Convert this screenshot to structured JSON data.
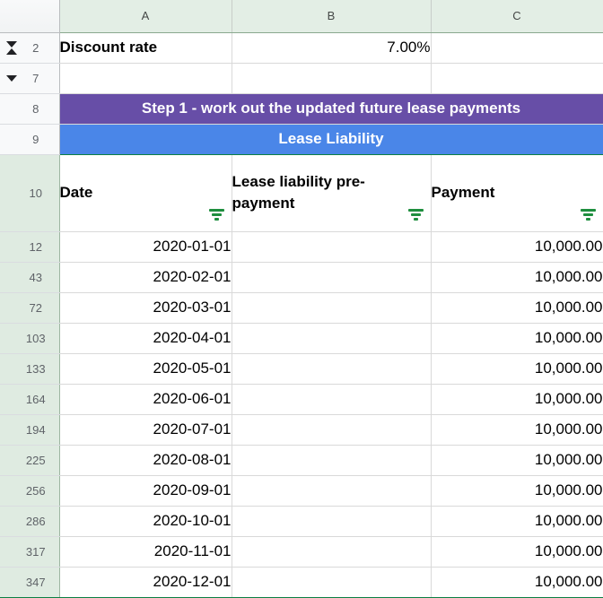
{
  "app": {
    "type": "spreadsheet",
    "colors": {
      "banner_step": "#674ea7",
      "banner_section": "#4a86e8",
      "filter_green": "#1e8e3e",
      "header_selected": "#e3eee5",
      "rowheader_selected": "#dfebe1"
    }
  },
  "columns": [
    {
      "id": "rowhdr",
      "label": ""
    },
    {
      "id": "A",
      "label": "A"
    },
    {
      "id": "B",
      "label": "B"
    },
    {
      "id": "C",
      "label": "C"
    }
  ],
  "icons": {
    "group_collapse_double": "collapse-expand-double-icon",
    "group_collapse_down": "collapse-down-icon",
    "filter": "filter-funnel-icon"
  },
  "rows": [
    {
      "num": "2",
      "selected": false,
      "group_icon": "double",
      "cells": [
        {
          "col": "A",
          "value": "Discount rate",
          "align": "left",
          "bold": true
        },
        {
          "col": "B",
          "value": "7.00%",
          "align": "right",
          "bold": false
        },
        {
          "col": "C",
          "value": "",
          "align": "left",
          "bold": false
        }
      ]
    },
    {
      "num": "7",
      "selected": false,
      "group_icon": "down",
      "cells": [
        {
          "col": "A",
          "value": "",
          "align": "left",
          "bold": false
        },
        {
          "col": "B",
          "value": "",
          "align": "left",
          "bold": false
        },
        {
          "col": "C",
          "value": "",
          "align": "left",
          "bold": false
        }
      ]
    },
    {
      "num": "8",
      "selected": false,
      "group_icon": null,
      "banner": {
        "style": "purple",
        "text": "Step 1 - work out the updated future lease payments"
      }
    },
    {
      "num": "9",
      "selected": false,
      "group_icon": null,
      "banner": {
        "style": "blue",
        "text": "Lease Liability"
      }
    },
    {
      "num": "10",
      "selected": true,
      "group_icon": null,
      "header_row": {
        "date_label": "Date",
        "liability_label": "Lease liability pre-payment",
        "payment_label": "Payment"
      }
    },
    {
      "num": "12",
      "selected": true,
      "group_icon": null,
      "cells": [
        {
          "col": "A",
          "value": "2020-01-01",
          "align": "right",
          "bold": false
        },
        {
          "col": "B",
          "value": "",
          "align": "left",
          "bold": false
        },
        {
          "col": "C",
          "value": "10,000.00",
          "align": "right",
          "bold": false
        }
      ]
    },
    {
      "num": "43",
      "selected": true,
      "group_icon": null,
      "cells": [
        {
          "col": "A",
          "value": "2020-02-01",
          "align": "right",
          "bold": false
        },
        {
          "col": "B",
          "value": "",
          "align": "left",
          "bold": false
        },
        {
          "col": "C",
          "value": "10,000.00",
          "align": "right",
          "bold": false
        }
      ]
    },
    {
      "num": "72",
      "selected": true,
      "group_icon": null,
      "cells": [
        {
          "col": "A",
          "value": "2020-03-01",
          "align": "right",
          "bold": false
        },
        {
          "col": "B",
          "value": "",
          "align": "left",
          "bold": false
        },
        {
          "col": "C",
          "value": "10,000.00",
          "align": "right",
          "bold": false
        }
      ]
    },
    {
      "num": "103",
      "selected": true,
      "group_icon": null,
      "cells": [
        {
          "col": "A",
          "value": "2020-04-01",
          "align": "right",
          "bold": false
        },
        {
          "col": "B",
          "value": "",
          "align": "left",
          "bold": false
        },
        {
          "col": "C",
          "value": "10,000.00",
          "align": "right",
          "bold": false
        }
      ]
    },
    {
      "num": "133",
      "selected": true,
      "group_icon": null,
      "cells": [
        {
          "col": "A",
          "value": "2020-05-01",
          "align": "right",
          "bold": false
        },
        {
          "col": "B",
          "value": "",
          "align": "left",
          "bold": false
        },
        {
          "col": "C",
          "value": "10,000.00",
          "align": "right",
          "bold": false
        }
      ]
    },
    {
      "num": "164",
      "selected": true,
      "group_icon": null,
      "cells": [
        {
          "col": "A",
          "value": "2020-06-01",
          "align": "right",
          "bold": false
        },
        {
          "col": "B",
          "value": "",
          "align": "left",
          "bold": false
        },
        {
          "col": "C",
          "value": "10,000.00",
          "align": "right",
          "bold": false
        }
      ]
    },
    {
      "num": "194",
      "selected": true,
      "group_icon": null,
      "cells": [
        {
          "col": "A",
          "value": "2020-07-01",
          "align": "right",
          "bold": false
        },
        {
          "col": "B",
          "value": "",
          "align": "left",
          "bold": false
        },
        {
          "col": "C",
          "value": "10,000.00",
          "align": "right",
          "bold": false
        }
      ]
    },
    {
      "num": "225",
      "selected": true,
      "group_icon": null,
      "cells": [
        {
          "col": "A",
          "value": "2020-08-01",
          "align": "right",
          "bold": false
        },
        {
          "col": "B",
          "value": "",
          "align": "left",
          "bold": false
        },
        {
          "col": "C",
          "value": "10,000.00",
          "align": "right",
          "bold": false
        }
      ]
    },
    {
      "num": "256",
      "selected": true,
      "group_icon": null,
      "cells": [
        {
          "col": "A",
          "value": "2020-09-01",
          "align": "right",
          "bold": false
        },
        {
          "col": "B",
          "value": "",
          "align": "left",
          "bold": false
        },
        {
          "col": "C",
          "value": "10,000.00",
          "align": "right",
          "bold": false
        }
      ]
    },
    {
      "num": "286",
      "selected": true,
      "group_icon": null,
      "cells": [
        {
          "col": "A",
          "value": "2020-10-01",
          "align": "right",
          "bold": false
        },
        {
          "col": "B",
          "value": "",
          "align": "left",
          "bold": false
        },
        {
          "col": "C",
          "value": "10,000.00",
          "align": "right",
          "bold": false
        }
      ]
    },
    {
      "num": "317",
      "selected": true,
      "group_icon": null,
      "cells": [
        {
          "col": "A",
          "value": "2020-11-01",
          "align": "right",
          "bold": false
        },
        {
          "col": "B",
          "value": "",
          "align": "left",
          "bold": false
        },
        {
          "col": "C",
          "value": "10,000.00",
          "align": "right",
          "bold": false
        }
      ]
    },
    {
      "num": "347",
      "selected": true,
      "group_icon": null,
      "last": true,
      "cells": [
        {
          "col": "A",
          "value": "2020-12-01",
          "align": "right",
          "bold": false
        },
        {
          "col": "B",
          "value": "",
          "align": "left",
          "bold": false
        },
        {
          "col": "C",
          "value": "10,000.00",
          "align": "right",
          "bold": false
        }
      ]
    }
  ]
}
